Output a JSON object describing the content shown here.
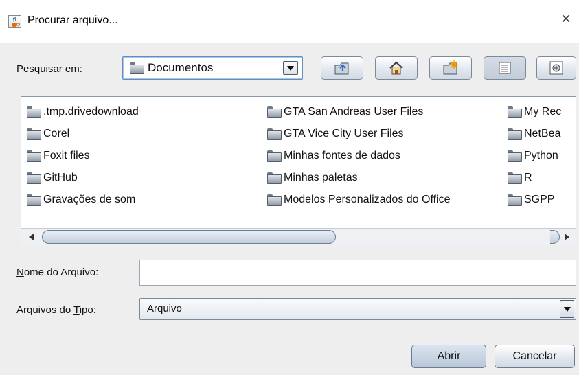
{
  "window": {
    "title": "Procurar arquivo...",
    "close_glyph": "×",
    "app_icon": "java-cup-icon"
  },
  "toolbar": {
    "look_in_label_pre": "P",
    "look_in_label_mnemonic": "e",
    "look_in_label_post": "squisar em:",
    "look_in_value": "Documentos",
    "buttons": [
      {
        "name": "up-folder-button",
        "icon": "up-folder-icon"
      },
      {
        "name": "home-button",
        "icon": "home-icon"
      },
      {
        "name": "new-folder-button",
        "icon": "new-folder-icon"
      },
      {
        "name": "list-view-button",
        "icon": "list-view-icon",
        "selected": true
      },
      {
        "name": "details-view-button",
        "icon": "details-view-icon",
        "selected": false
      }
    ]
  },
  "files": {
    "column1": [
      ".tmp.drivedownload",
      "Corel",
      "Foxit files",
      "GitHub",
      "Gravações de som"
    ],
    "column2": [
      "GTA San Andreas User Files",
      "GTA Vice City User Files",
      "Minhas fontes de dados",
      "Minhas paletas",
      "Modelos Personalizados do Office"
    ],
    "column3": [
      "My Rec",
      "NetBea",
      "Python",
      "R",
      "SGPP"
    ]
  },
  "filename": {
    "label_mnemonic": "N",
    "label_post": "ome do Arquivo:",
    "value": ""
  },
  "filetype": {
    "label_pre": "Arquivos do ",
    "label_mnemonic": "T",
    "label_post": "ipo:",
    "value": "Arquivo"
  },
  "actions": {
    "open_label": "Abrir",
    "cancel_label": "Cancelar"
  },
  "colors": {
    "window_bg": "#eeeeee",
    "primary_button": "#b7c6d8",
    "border": "#7a8a9c"
  }
}
